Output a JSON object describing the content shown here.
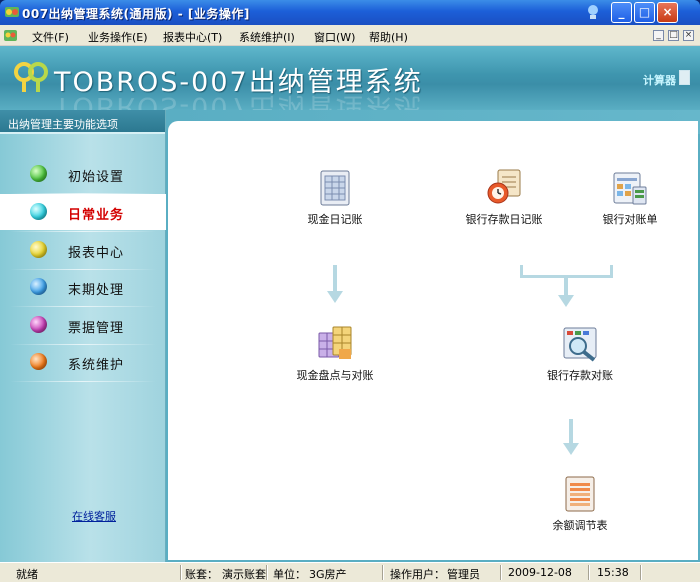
{
  "window": {
    "title": "007出纳管理系统(通用版) - [业务操作]",
    "minimize": "_",
    "maximize": "□",
    "close": "×"
  },
  "menu": {
    "items": [
      "文件(F)",
      "业务操作(E)",
      "报表中心(T)",
      "系统维护(I)",
      "窗口(W)",
      "帮助(H)"
    ],
    "mdi": [
      "_",
      "□",
      "×"
    ]
  },
  "banner": {
    "brand": "TOBROS-007出纳管理系统",
    "calculator": "计算器"
  },
  "sidebar": {
    "header": "出纳管理主要功能选项",
    "items": [
      {
        "label": "初始设置",
        "color": "#4cc23d"
      },
      {
        "label": "日常业务",
        "color": "#2fd0e0",
        "active": true
      },
      {
        "label": "报表中心",
        "color": "#e6d22a"
      },
      {
        "label": "末期处理",
        "color": "#3b9fe8"
      },
      {
        "label": "票据管理",
        "color": "#c43fb4"
      },
      {
        "label": "系统维护",
        "color": "#f07a1a"
      }
    ],
    "online_service": "在线客服"
  },
  "main": {
    "functions": {
      "cash_journal": "现金日记账",
      "bank_journal": "银行存款日记账",
      "bank_statement": "银行对账单",
      "cash_count": "现金盘点与对账",
      "bank_reconcile": "银行存款对账",
      "balance_table": "余额调节表"
    }
  },
  "statusbar": {
    "ready": "就绪",
    "account_label": "账套：",
    "account_value": "演示账套",
    "unit_label": "单位：",
    "unit_value": "3G房产",
    "operator_label": "操作用户：",
    "operator_value": "管理员",
    "date": "2009-12-08",
    "time": "15:38"
  }
}
